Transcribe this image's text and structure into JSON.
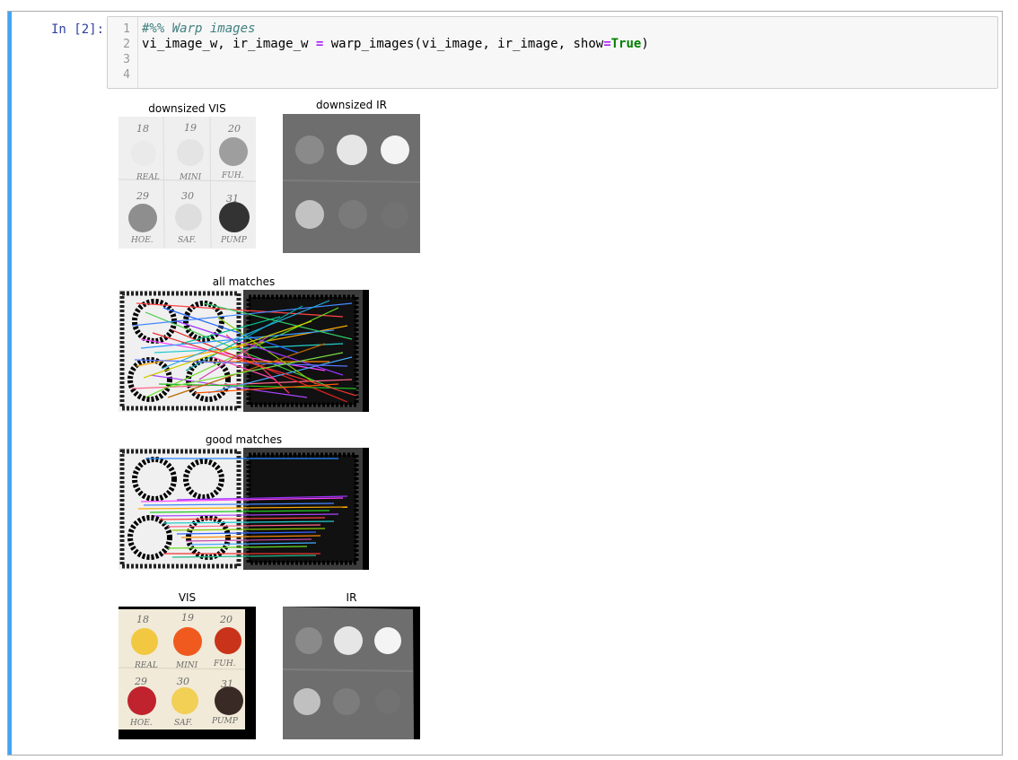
{
  "cell": {
    "prompt": "In [2]:",
    "line_numbers": [
      "1",
      "2",
      "3",
      "4"
    ],
    "code": {
      "comment": "#%% Warp images",
      "assign_lhs": "vi_image_w, ir_image_w ",
      "assign_op": "=",
      "call": " warp_images(vi_image, ir_image, show",
      "kw_op": "=",
      "kw_value": "True",
      "close": ")"
    }
  },
  "output": {
    "downsized_vis": {
      "title": "downsized VIS",
      "top_labels": [
        "18",
        "19",
        "20"
      ],
      "mid_labels": [
        "REAL",
        "MINI",
        "FUH."
      ],
      "row2_labels": [
        "29",
        "30",
        "31"
      ],
      "bottom_labels": [
        "HOE.",
        "SAF.",
        "PUMP"
      ]
    },
    "downsized_ir": {
      "title": "downsized IR"
    },
    "all_matches": {
      "title": "all matches"
    },
    "good_matches": {
      "title": "good matches"
    },
    "vis": {
      "title": "VIS",
      "top_labels": [
        "18",
        "19",
        "20"
      ],
      "mid_labels": [
        "REAL",
        "MINI",
        "FUH."
      ],
      "row2_labels": [
        "29",
        "30",
        "31"
      ],
      "bottom_labels": [
        "HOE.",
        "SAF.",
        "PUMP"
      ]
    },
    "ir": {
      "title": "IR"
    }
  },
  "colors": {
    "cell_accent": "#42a5f5",
    "prompt": "#303f9f",
    "comment": "#408080",
    "operator": "#aa22ff",
    "keyword": "#008000"
  }
}
